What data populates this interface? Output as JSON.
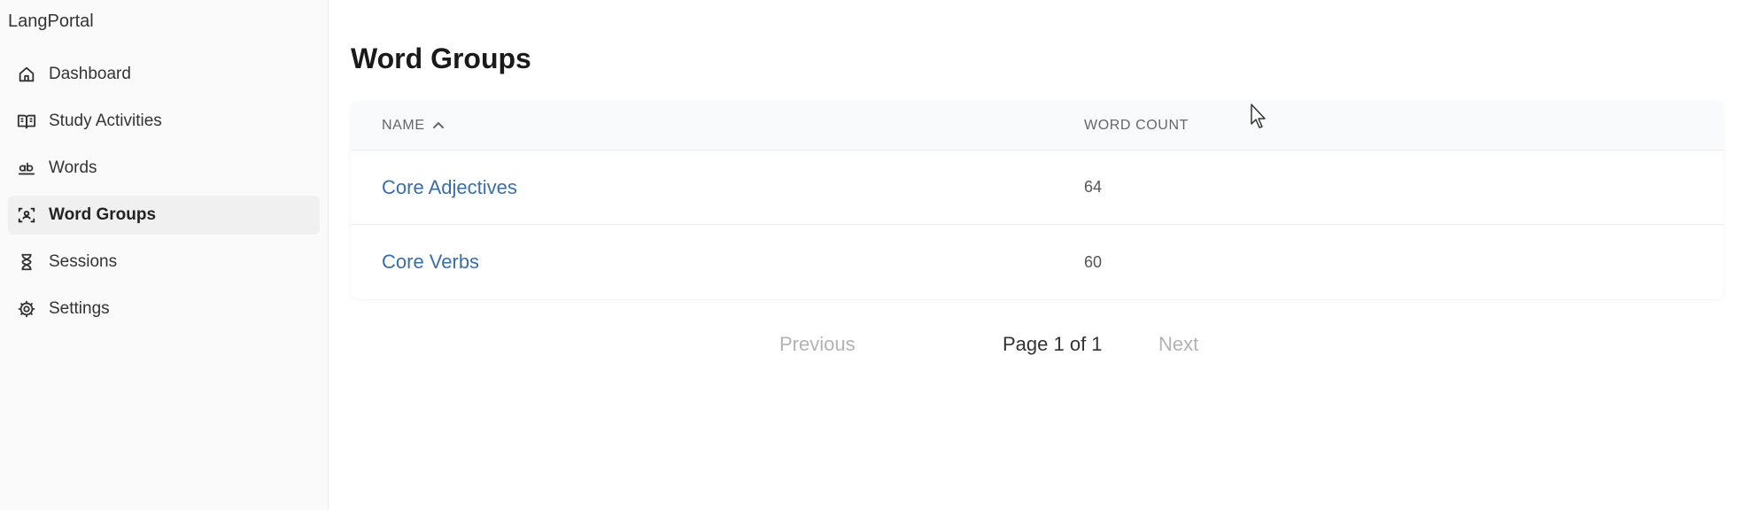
{
  "app": {
    "brand": "LangPortal"
  },
  "sidebar": {
    "items": [
      {
        "label": "Dashboard",
        "icon": "home-icon",
        "active": false
      },
      {
        "label": "Study Activities",
        "icon": "book-open-icon",
        "active": false
      },
      {
        "label": "Words",
        "icon": "ab-text-icon",
        "active": false
      },
      {
        "label": "Word Groups",
        "icon": "group-scan-icon",
        "active": true
      },
      {
        "label": "Sessions",
        "icon": "hourglass-icon",
        "active": false
      },
      {
        "label": "Settings",
        "icon": "gear-icon",
        "active": false
      }
    ]
  },
  "main": {
    "title": "Word Groups",
    "table": {
      "columns": {
        "name": "NAME",
        "count": "WORD COUNT"
      },
      "sort": "name-ascending",
      "rows": [
        {
          "name": "Core Adjectives",
          "count": "64"
        },
        {
          "name": "Core Verbs",
          "count": "60"
        }
      ]
    },
    "pagination": {
      "previous": "Previous",
      "info": "Page 1 of 1",
      "next": "Next"
    }
  },
  "colors": {
    "link": "#3b6ea5",
    "active_bg": "#f0f0f0",
    "disabled": "#b3b3b3"
  }
}
